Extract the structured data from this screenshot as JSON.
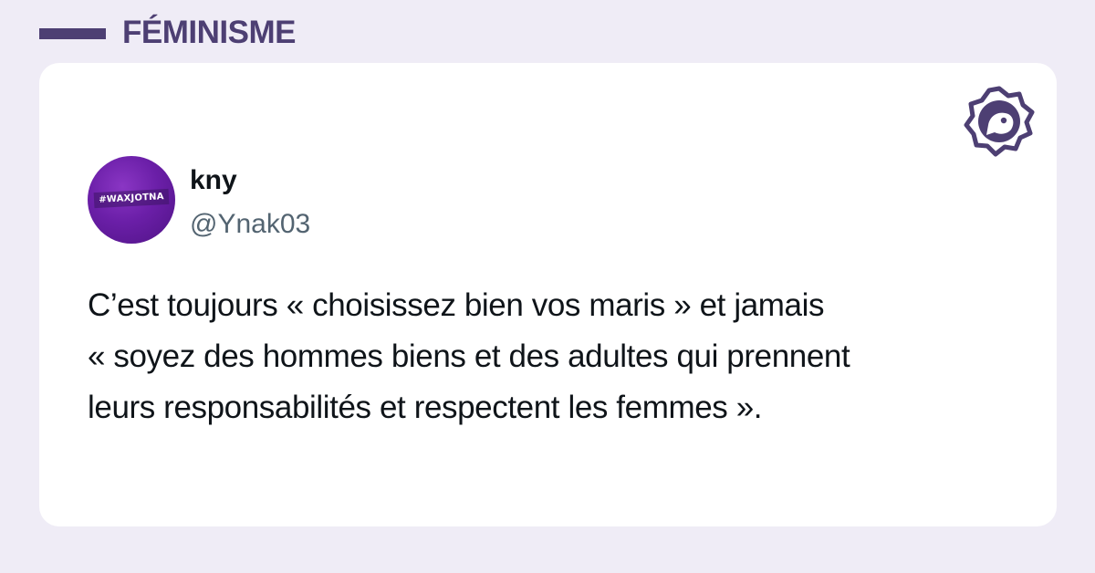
{
  "category": {
    "label": "FÉMINISME"
  },
  "brand": {
    "icon": "bird-badge-icon",
    "color": "#4d3f73"
  },
  "tweet": {
    "author": {
      "name": "kny",
      "handle": "@Ynak03",
      "avatar_text": "#WAXJOTNA"
    },
    "text_lines": [
      "C’est toujours « choisissez bien vos maris » et jamais",
      "« soyez des hommes biens et des adultes qui prennent",
      "leurs responsabilités et respectent les femmes »."
    ]
  },
  "colors": {
    "background": "#efecf6",
    "accent": "#4d3f73",
    "card": "#ffffff",
    "text": "#0f1419",
    "muted": "#536471",
    "avatar": "#6b1fa8"
  }
}
